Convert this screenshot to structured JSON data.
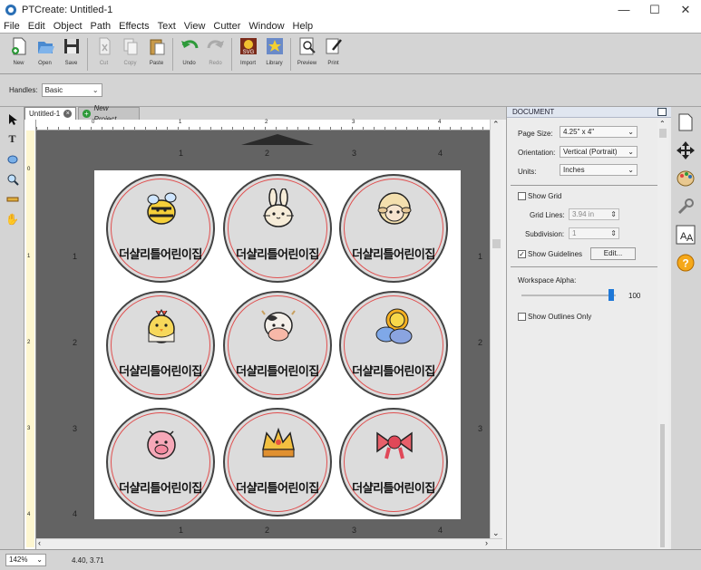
{
  "window": {
    "title": "PTCreate: Untitled-1",
    "minimize": "—",
    "maximize": "☐",
    "close": "✕"
  },
  "menu": [
    "File",
    "Edit",
    "Object",
    "Path",
    "Effects",
    "Text",
    "View",
    "Cutter",
    "Window",
    "Help"
  ],
  "toolbar": [
    {
      "label": "New",
      "icon": "new-doc-icon",
      "enabled": true
    },
    {
      "label": "Open",
      "icon": "open-icon",
      "enabled": true
    },
    {
      "label": "Save",
      "icon": "save-icon",
      "enabled": true
    },
    {
      "label": "Cut",
      "icon": "cut-icon",
      "enabled": false
    },
    {
      "label": "Copy",
      "icon": "copy-icon",
      "enabled": false
    },
    {
      "label": "Paste",
      "icon": "paste-icon",
      "enabled": true
    },
    {
      "label": "Undo",
      "icon": "undo-icon",
      "enabled": true
    },
    {
      "label": "Redo",
      "icon": "redo-icon",
      "enabled": false
    },
    {
      "label": "Import",
      "icon": "import-svg-icon",
      "enabled": true
    },
    {
      "label": "Library",
      "icon": "library-icon",
      "enabled": true
    },
    {
      "label": "Preview",
      "icon": "preview-icon",
      "enabled": true
    },
    {
      "label": "Print",
      "icon": "print-icon",
      "enabled": true
    }
  ],
  "handles": {
    "label": "Handles:",
    "value": "Basic"
  },
  "tabs": {
    "active": "Untitled-1",
    "new": "New Project..."
  },
  "ruler": {
    "top": [
      "0",
      "1",
      "2",
      "3",
      "4"
    ],
    "left": [
      "0",
      "1",
      "2",
      "3",
      "4"
    ]
  },
  "workspace_ruler": {
    "top": [
      "1",
      "2",
      "3",
      "4"
    ],
    "bottom": [
      "1",
      "2",
      "3",
      "4"
    ],
    "left": [
      "1",
      "2",
      "3",
      "4"
    ],
    "right": [
      "1",
      "2",
      "3"
    ]
  },
  "stickers": {
    "caption": "더샬리틀어린이집",
    "items": [
      "bee",
      "rabbit",
      "sheep",
      "chick",
      "cow",
      "sun-cloud",
      "pig",
      "crown",
      "bow"
    ]
  },
  "panel": {
    "title": "DOCUMENT",
    "page_size_label": "Page Size:",
    "page_size_value": "4.25\" x 4\"",
    "orientation_label": "Orientation:",
    "orientation_value": "Vertical (Portrait)",
    "units_label": "Units:",
    "units_value": "Inches",
    "show_grid": "Show Grid",
    "show_grid_checked": false,
    "grid_lines_label": "Grid Lines:",
    "grid_lines_value": "3.94 in",
    "subdivision_label": "Subdivision:",
    "subdivision_value": "1",
    "show_guidelines": "Show Guidelines",
    "show_guidelines_checked": true,
    "edit_button": "Edit...",
    "workspace_alpha_label": "Workspace Alpha:",
    "workspace_alpha_value": "100",
    "workspace_alpha_fraction": 1.0,
    "show_outlines": "Show Outlines Only",
    "show_outlines_checked": false
  },
  "status": {
    "zoom": "142%",
    "coords": "4.40, 3.71"
  },
  "colors": {
    "accent": "#1e78d8",
    "sticker_ring": "#e05050",
    "sticker_fill": "#dcdcdc"
  }
}
